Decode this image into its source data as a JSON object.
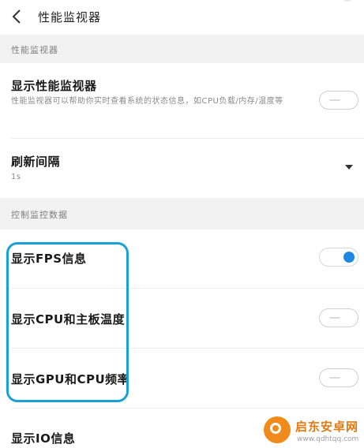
{
  "header": {
    "title": "性能监视器"
  },
  "sections": {
    "monitor": "性能监视器",
    "control": "控制监控数据"
  },
  "rows": {
    "show_monitor": {
      "title": "显示性能监视器",
      "desc": "性能监视器可以帮助你实时查看系统的状态信息，如CPU负载/内存/温度等",
      "toggle": "off"
    },
    "refresh": {
      "title": "刷新间隔",
      "value": "1s"
    },
    "fps": {
      "title": "显示FPS信息",
      "toggle": "on"
    },
    "cpu_temp": {
      "title": "显示CPU和主板温度",
      "toggle": "off"
    },
    "gpu_cpu_freq": {
      "title": "显示GPU和CPU频率",
      "toggle": "off"
    },
    "io": {
      "title": "显示IO信息"
    }
  },
  "watermark": {
    "name": "启东安卓网",
    "url": "www.qdhtqq.com"
  },
  "colors": {
    "toggle_on": "#1e88e5",
    "highlight": "#1aa0d8",
    "section_bg": "#f2f2f2"
  }
}
